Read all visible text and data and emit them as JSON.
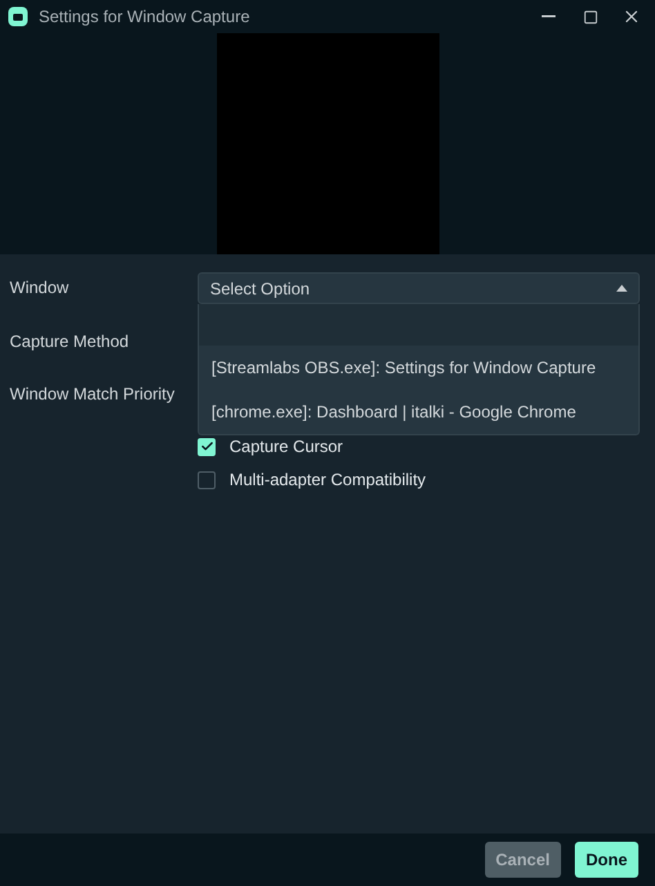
{
  "window": {
    "title": "Settings for Window Capture"
  },
  "fields": [
    {
      "label": "Window"
    },
    {
      "label": "Capture Method"
    },
    {
      "label": "Window Match Priority"
    }
  ],
  "window_select": {
    "value": "Select Option",
    "expanded": true,
    "options": [
      {
        "label": "[Streamlabs OBS.exe]: Settings for Window Capture"
      },
      {
        "label": "[chrome.exe]: Dashboard | italki - Google Chrome"
      }
    ]
  },
  "checkboxes": [
    {
      "label": "Capture Cursor",
      "checked": true
    },
    {
      "label": "Multi-adapter Compatibility",
      "checked": false
    }
  ],
  "buttons": [
    {
      "label": "Cancel",
      "kind": "secondary"
    },
    {
      "label": "Done",
      "kind": "primary"
    }
  ]
}
